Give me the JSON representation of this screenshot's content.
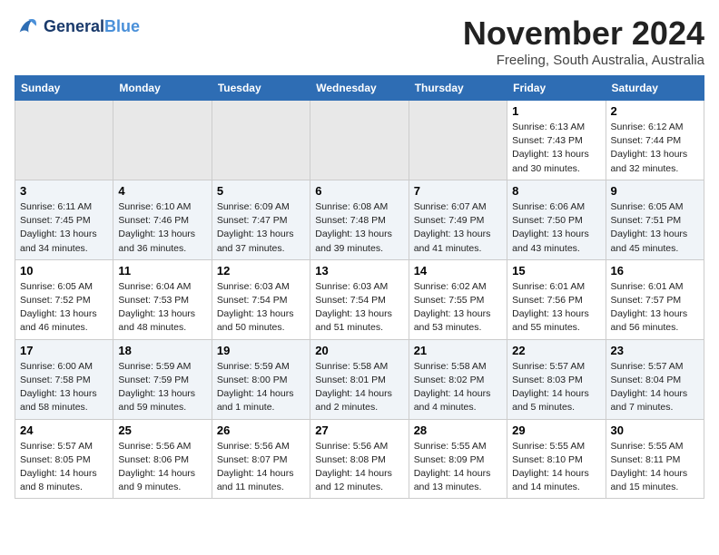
{
  "header": {
    "logo_line1": "General",
    "logo_line2": "Blue",
    "month": "November 2024",
    "location": "Freeling, South Australia, Australia"
  },
  "days_of_week": [
    "Sunday",
    "Monday",
    "Tuesday",
    "Wednesday",
    "Thursday",
    "Friday",
    "Saturday"
  ],
  "weeks": [
    [
      {
        "date": "",
        "info": ""
      },
      {
        "date": "",
        "info": ""
      },
      {
        "date": "",
        "info": ""
      },
      {
        "date": "",
        "info": ""
      },
      {
        "date": "",
        "info": ""
      },
      {
        "date": "1",
        "info": "Sunrise: 6:13 AM\nSunset: 7:43 PM\nDaylight: 13 hours\nand 30 minutes."
      },
      {
        "date": "2",
        "info": "Sunrise: 6:12 AM\nSunset: 7:44 PM\nDaylight: 13 hours\nand 32 minutes."
      }
    ],
    [
      {
        "date": "3",
        "info": "Sunrise: 6:11 AM\nSunset: 7:45 PM\nDaylight: 13 hours\nand 34 minutes."
      },
      {
        "date": "4",
        "info": "Sunrise: 6:10 AM\nSunset: 7:46 PM\nDaylight: 13 hours\nand 36 minutes."
      },
      {
        "date": "5",
        "info": "Sunrise: 6:09 AM\nSunset: 7:47 PM\nDaylight: 13 hours\nand 37 minutes."
      },
      {
        "date": "6",
        "info": "Sunrise: 6:08 AM\nSunset: 7:48 PM\nDaylight: 13 hours\nand 39 minutes."
      },
      {
        "date": "7",
        "info": "Sunrise: 6:07 AM\nSunset: 7:49 PM\nDaylight: 13 hours\nand 41 minutes."
      },
      {
        "date": "8",
        "info": "Sunrise: 6:06 AM\nSunset: 7:50 PM\nDaylight: 13 hours\nand 43 minutes."
      },
      {
        "date": "9",
        "info": "Sunrise: 6:05 AM\nSunset: 7:51 PM\nDaylight: 13 hours\nand 45 minutes."
      }
    ],
    [
      {
        "date": "10",
        "info": "Sunrise: 6:05 AM\nSunset: 7:52 PM\nDaylight: 13 hours\nand 46 minutes."
      },
      {
        "date": "11",
        "info": "Sunrise: 6:04 AM\nSunset: 7:53 PM\nDaylight: 13 hours\nand 48 minutes."
      },
      {
        "date": "12",
        "info": "Sunrise: 6:03 AM\nSunset: 7:54 PM\nDaylight: 13 hours\nand 50 minutes."
      },
      {
        "date": "13",
        "info": "Sunrise: 6:03 AM\nSunset: 7:54 PM\nDaylight: 13 hours\nand 51 minutes."
      },
      {
        "date": "14",
        "info": "Sunrise: 6:02 AM\nSunset: 7:55 PM\nDaylight: 13 hours\nand 53 minutes."
      },
      {
        "date": "15",
        "info": "Sunrise: 6:01 AM\nSunset: 7:56 PM\nDaylight: 13 hours\nand 55 minutes."
      },
      {
        "date": "16",
        "info": "Sunrise: 6:01 AM\nSunset: 7:57 PM\nDaylight: 13 hours\nand 56 minutes."
      }
    ],
    [
      {
        "date": "17",
        "info": "Sunrise: 6:00 AM\nSunset: 7:58 PM\nDaylight: 13 hours\nand 58 minutes."
      },
      {
        "date": "18",
        "info": "Sunrise: 5:59 AM\nSunset: 7:59 PM\nDaylight: 13 hours\nand 59 minutes."
      },
      {
        "date": "19",
        "info": "Sunrise: 5:59 AM\nSunset: 8:00 PM\nDaylight: 14 hours\nand 1 minute."
      },
      {
        "date": "20",
        "info": "Sunrise: 5:58 AM\nSunset: 8:01 PM\nDaylight: 14 hours\nand 2 minutes."
      },
      {
        "date": "21",
        "info": "Sunrise: 5:58 AM\nSunset: 8:02 PM\nDaylight: 14 hours\nand 4 minutes."
      },
      {
        "date": "22",
        "info": "Sunrise: 5:57 AM\nSunset: 8:03 PM\nDaylight: 14 hours\nand 5 minutes."
      },
      {
        "date": "23",
        "info": "Sunrise: 5:57 AM\nSunset: 8:04 PM\nDaylight: 14 hours\nand 7 minutes."
      }
    ],
    [
      {
        "date": "24",
        "info": "Sunrise: 5:57 AM\nSunset: 8:05 PM\nDaylight: 14 hours\nand 8 minutes."
      },
      {
        "date": "25",
        "info": "Sunrise: 5:56 AM\nSunset: 8:06 PM\nDaylight: 14 hours\nand 9 minutes."
      },
      {
        "date": "26",
        "info": "Sunrise: 5:56 AM\nSunset: 8:07 PM\nDaylight: 14 hours\nand 11 minutes."
      },
      {
        "date": "27",
        "info": "Sunrise: 5:56 AM\nSunset: 8:08 PM\nDaylight: 14 hours\nand 12 minutes."
      },
      {
        "date": "28",
        "info": "Sunrise: 5:55 AM\nSunset: 8:09 PM\nDaylight: 14 hours\nand 13 minutes."
      },
      {
        "date": "29",
        "info": "Sunrise: 5:55 AM\nSunset: 8:10 PM\nDaylight: 14 hours\nand 14 minutes."
      },
      {
        "date": "30",
        "info": "Sunrise: 5:55 AM\nSunset: 8:11 PM\nDaylight: 14 hours\nand 15 minutes."
      }
    ]
  ]
}
